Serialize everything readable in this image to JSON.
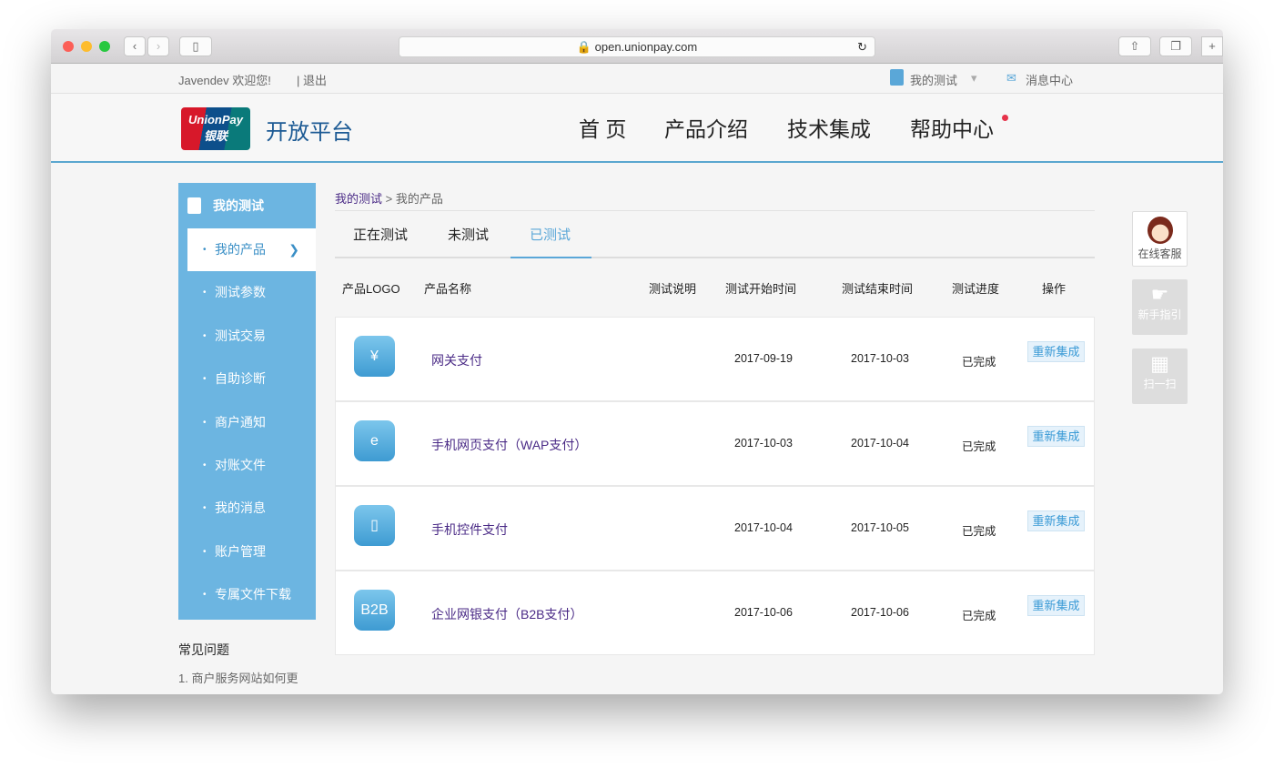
{
  "browser": {
    "url": "open.unionpay.com"
  },
  "topbar": {
    "welcome": "Javendev 欢迎您!",
    "logout": "| 退出",
    "my_test": "我的测试",
    "messages": "消息中心"
  },
  "header": {
    "brand": "开放平台",
    "logo_text": "UnionPay",
    "logo_cn": "银联",
    "nav": [
      "首 页",
      "产品介绍",
      "技术集成",
      "帮助中心"
    ]
  },
  "sidebar": {
    "title": "我的测试",
    "items": [
      "我的产品",
      "测试参数",
      "测试交易",
      "自助诊断",
      "商户通知",
      "对账文件",
      "我的消息",
      "账户管理",
      "专属文件下载"
    ],
    "faq_title": "常见问题",
    "faq_item": "1. 商户服务网站如何更"
  },
  "breadcrumb": {
    "root": "我的测试",
    "sep": ">",
    "current": "我的产品"
  },
  "tabs": [
    "正在测试",
    "未测试",
    "已测试"
  ],
  "table": {
    "headers": [
      "产品LOGO",
      "产品名称",
      "测试说明",
      "测试开始时间",
      "测试结束时间",
      "测试进度",
      "操作"
    ],
    "rows": [
      {
        "logo": "¥",
        "name": "网关支付",
        "start": "2017-09-19",
        "end": "2017-10-03",
        "status": "已完成",
        "action": "重新集成"
      },
      {
        "logo": "e",
        "name": "手机网页支付（WAP支付）",
        "start": "2017-10-03",
        "end": "2017-10-04",
        "status": "已完成",
        "action": "重新集成"
      },
      {
        "logo": "▯",
        "name": "手机控件支付",
        "start": "2017-10-04",
        "end": "2017-10-05",
        "status": "已完成",
        "action": "重新集成"
      },
      {
        "logo": "B2B",
        "name": "企业网银支付（B2B支付）",
        "start": "2017-10-06",
        "end": "2017-10-06",
        "status": "已完成",
        "action": "重新集成"
      }
    ]
  },
  "float": {
    "service": "在线客服",
    "guide": "新手指引",
    "scan": "扫一扫"
  }
}
